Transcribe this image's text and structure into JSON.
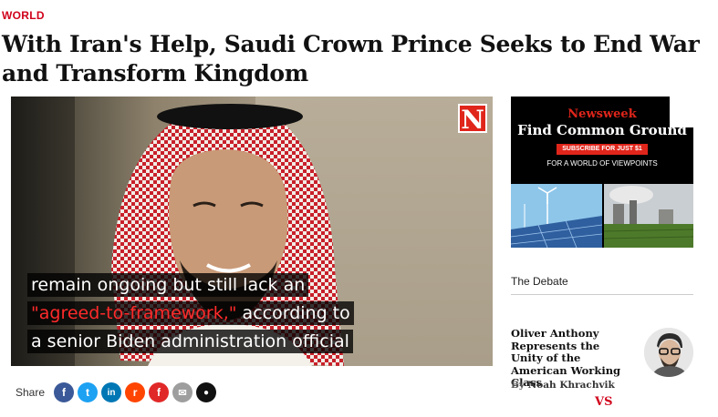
{
  "article": {
    "category": "WORLD",
    "headline": "With Iran's Help, Saudi Crown Prince Seeks to End War and Transform Kingdom"
  },
  "video": {
    "logo": "N",
    "caption": {
      "line1": "remain ongoing but still lack an",
      "line2_highlight": "\"agreed-to-framework,\"",
      "line2_rest": " according to",
      "line3": "a senior Biden administration official"
    },
    "highlight_color": "#ff2a2a"
  },
  "share": {
    "label": "Share",
    "icons": [
      {
        "name": "facebook-icon",
        "glyph": "f",
        "color": "#3b5998"
      },
      {
        "name": "twitter-icon",
        "glyph": "t",
        "color": "#1da1f2"
      },
      {
        "name": "linkedin-icon",
        "glyph": "in",
        "color": "#0077b5"
      },
      {
        "name": "reddit-icon",
        "glyph": "r",
        "color": "#ff4500"
      },
      {
        "name": "flipboard-icon",
        "glyph": "f",
        "color": "#e12828"
      },
      {
        "name": "email-icon",
        "glyph": "✉",
        "color": "#9e9e9e"
      },
      {
        "name": "comment-icon",
        "glyph": "●",
        "color": "#111111"
      }
    ]
  },
  "ad": {
    "brand": "Newsweek",
    "title": "Find Common Ground",
    "cta": "SUBSCRIBE FOR JUST $1",
    "subtitle": "FOR A WORLD OF VIEWPOINTS"
  },
  "sidebar": {
    "section_title": "The Debate",
    "story": {
      "title": "Oliver Anthony Represents the Unity of the American Working Class",
      "byline_prefix": "By ",
      "author": "Noah Khrachvik"
    },
    "vs_label": "VS"
  },
  "colors": {
    "accent_red": "#d0021b",
    "newsweek_red": "#e0251b"
  }
}
